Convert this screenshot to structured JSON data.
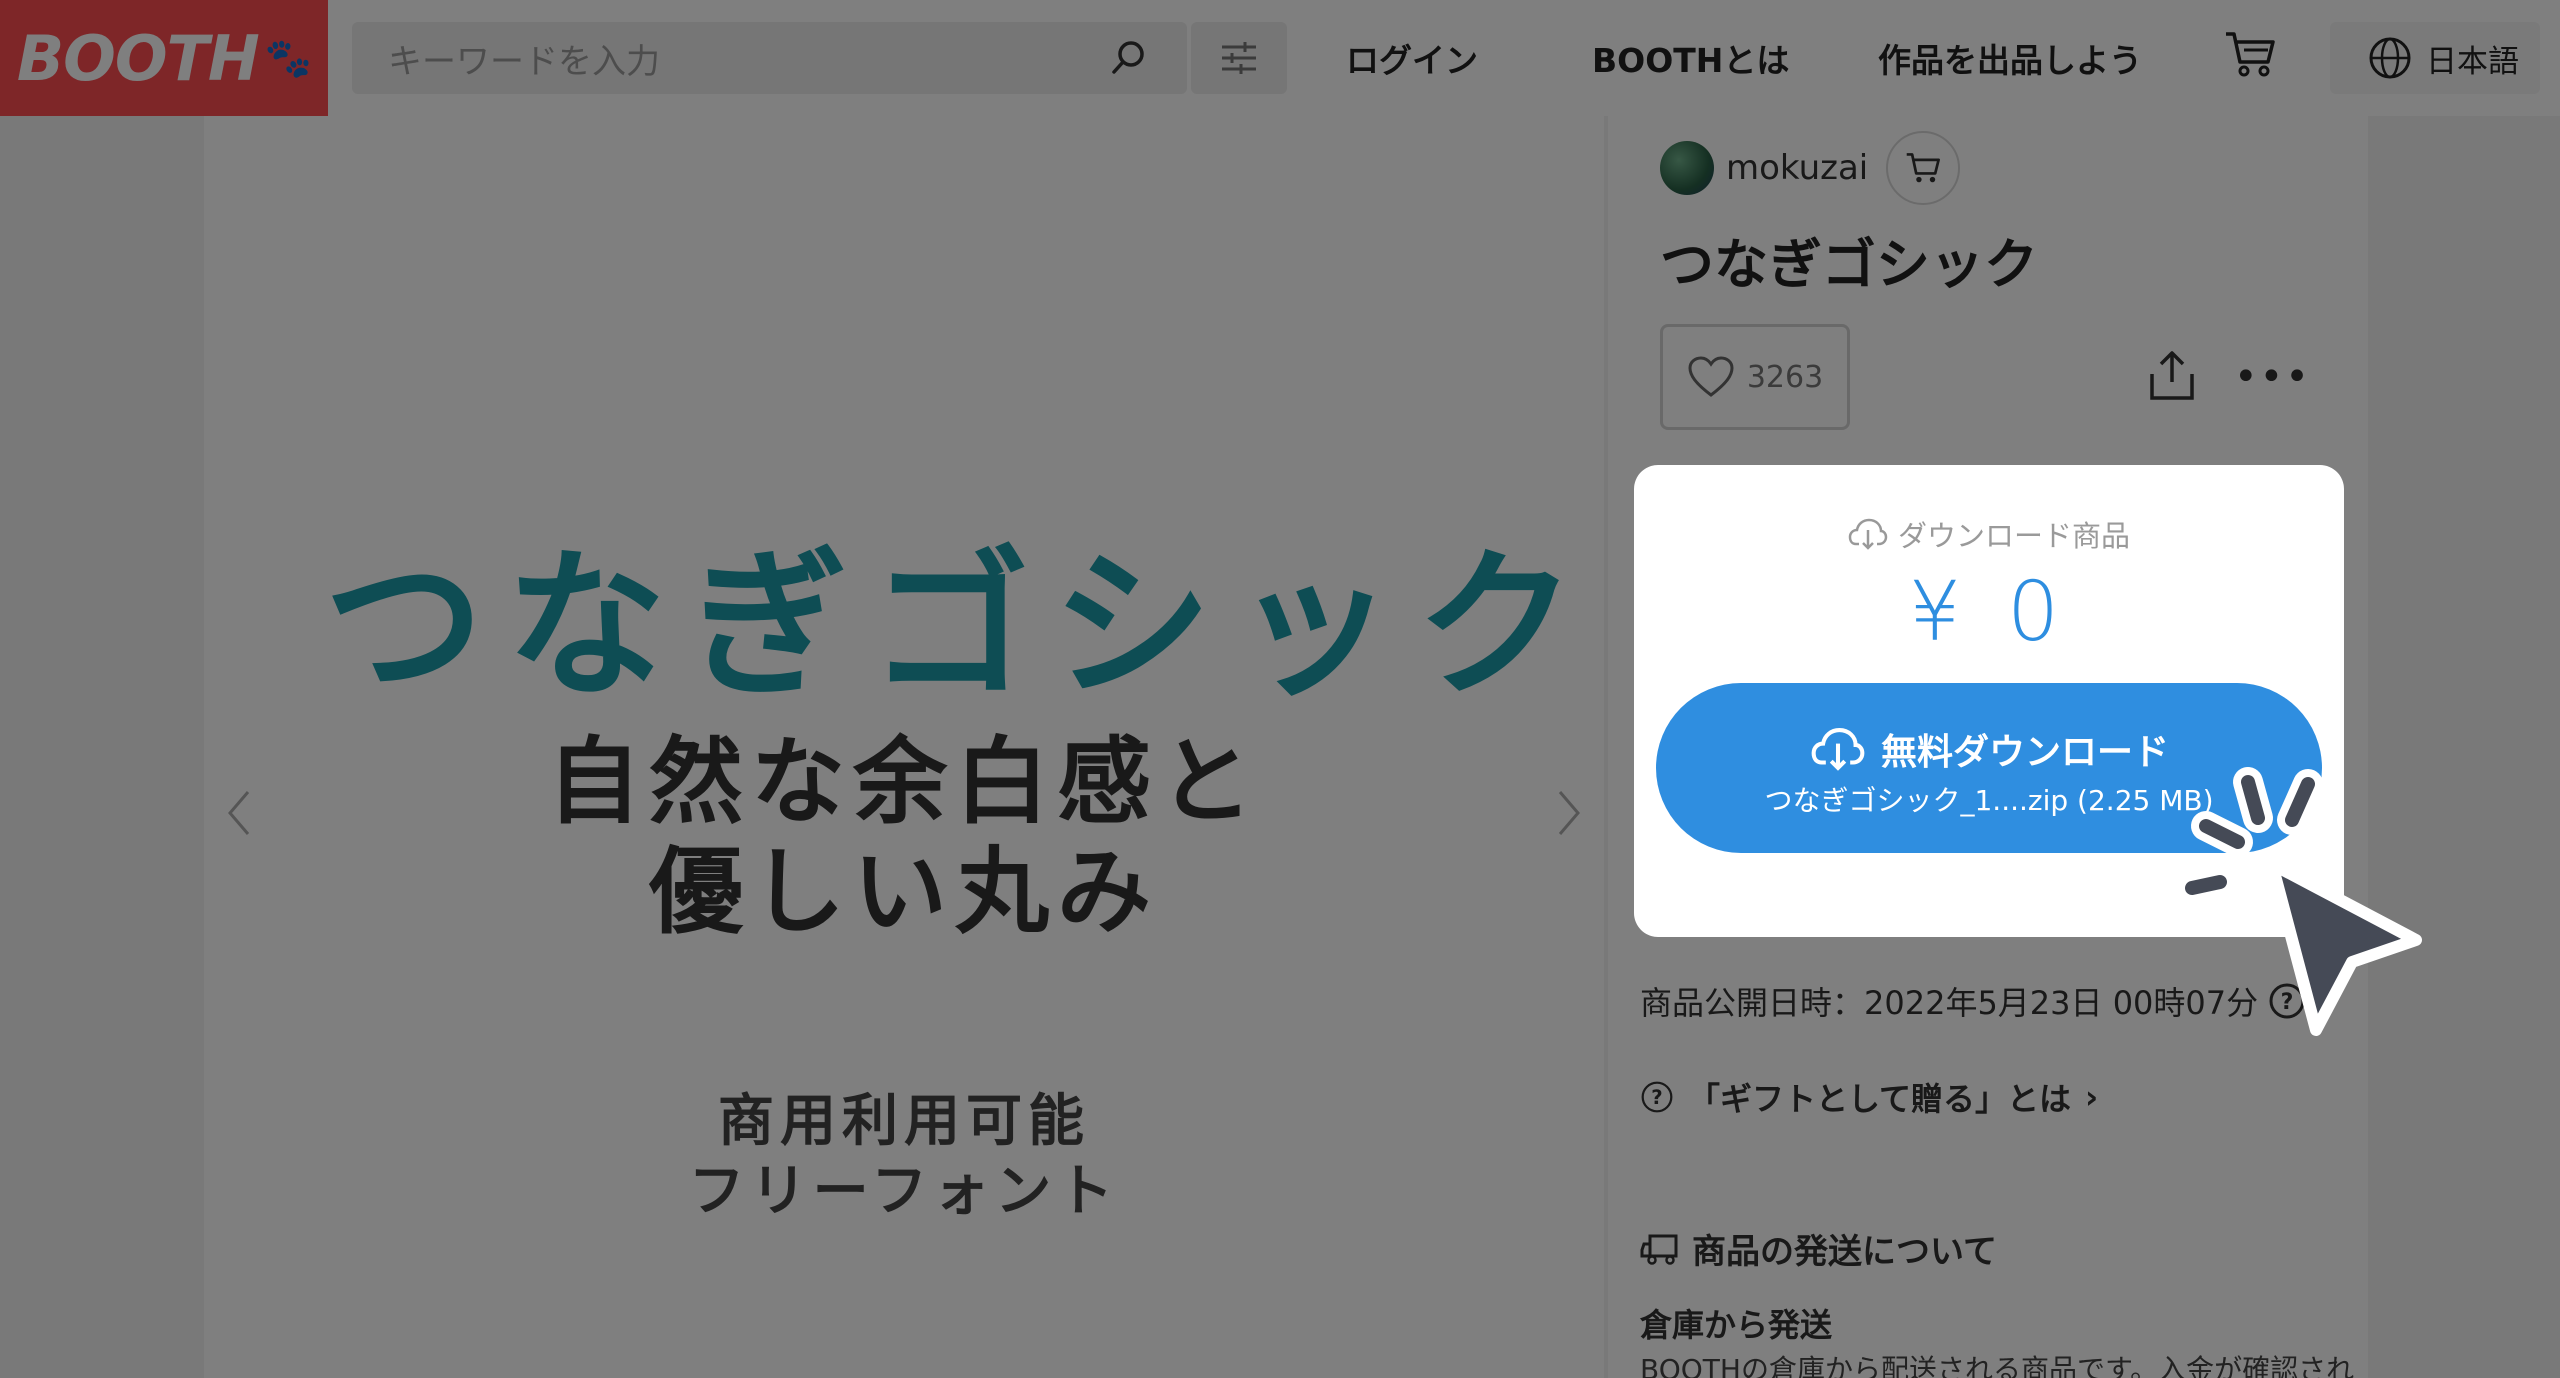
{
  "header": {
    "logo": "BOOTH",
    "search_placeholder": "キーワードを入力",
    "nav": [
      "ログイン",
      "BOOTHとは",
      "作品を出品しよう"
    ],
    "language": "日本語"
  },
  "gallery": {
    "title": "つなぎゴシック",
    "subtitle_line1": "自然な余白感と",
    "subtitle_line2": "優しい丸み",
    "note_line1": "商用利用可能",
    "note_line2": "フリーフォント"
  },
  "product": {
    "shop_name": "mokuzai",
    "title": "つなぎゴシック",
    "likes": "3263",
    "type_label": "ダウンロード商品",
    "price": "¥ 0",
    "download_label": "無料ダウンロード",
    "download_file": "つなぎゴシック_1....zip (2.25 MB)",
    "published": "商品公開日時：2022年5月23日 00時07分",
    "gift_link": "「ギフトとして贈る」とは",
    "shipping_heading": "商品の発送について",
    "shipping_sub": "倉庫から発送",
    "shipping_desc": "BOOTHの倉庫から配送される商品です。入金が確認され"
  },
  "colors": {
    "brand": "#fc4d50",
    "accent": "#2f8ee0",
    "title_teal": "#1d9aa8"
  },
  "icons": [
    "search-icon",
    "filter-icon",
    "cart-icon",
    "globe-icon",
    "heart-icon",
    "share-icon",
    "more-icon",
    "cloud-download-icon",
    "help-icon",
    "truck-icon",
    "pointer-cursor-icon"
  ]
}
